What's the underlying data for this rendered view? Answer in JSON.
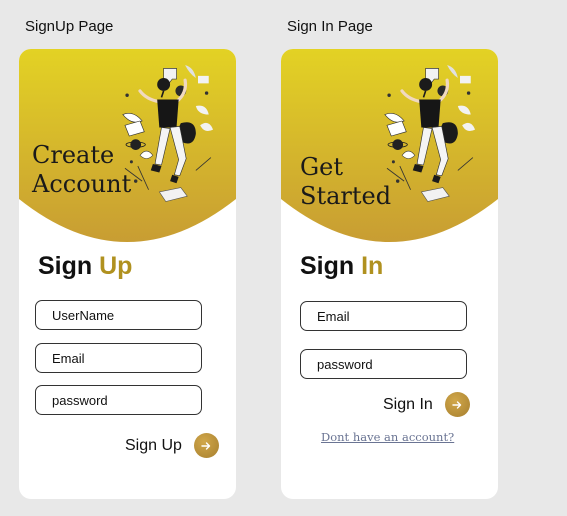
{
  "signup": {
    "page_label": "SignUp Page",
    "hero_title": "Create\nAccount",
    "heading_part1": "Sign ",
    "heading_part2": "Up",
    "username_placeholder": "UserName",
    "email_placeholder": "Email",
    "password_placeholder": "password",
    "submit_label": "Sign Up"
  },
  "signin": {
    "page_label": "Sign In Page",
    "hero_title": "Get\nStarted",
    "heading_part1": "Sign ",
    "heading_part2": "In",
    "email_placeholder": "Email",
    "password_placeholder": "password",
    "submit_label": "Sign In",
    "link_label": "Dont have an account?"
  },
  "colors": {
    "accent": "#b0911f",
    "gradient_top": "#e2cf22",
    "gradient_bottom": "#c9a231",
    "button": "#b58a35",
    "link": "#6a7493"
  }
}
